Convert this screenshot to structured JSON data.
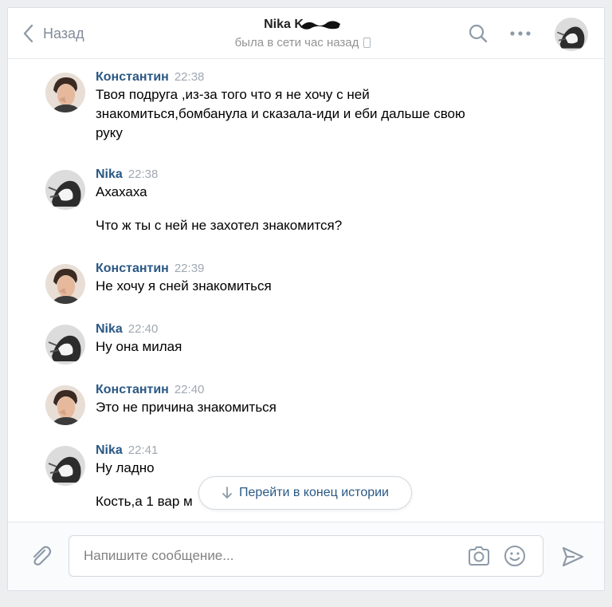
{
  "header": {
    "back_label": "Назад",
    "contact_name": "Nika K",
    "status": "была в сети час назад"
  },
  "messages": [
    {
      "author": "Константин",
      "time": "22:38",
      "texts": [
        "Твоя подруга ,из-за того что я не хочу с ней знакомиться,бомбанула и сказала-иди и еби дальше свою руку"
      ]
    },
    {
      "author": "Nika",
      "time": "22:38",
      "texts": [
        "Ахахаха",
        "Что ж ты с ней не захотел знакомится?"
      ]
    },
    {
      "author": "Константин",
      "time": "22:39",
      "texts": [
        "Не хочу я сней знакомиться"
      ]
    },
    {
      "author": "Nika",
      "time": "22:40",
      "texts": [
        "Ну она милая"
      ]
    },
    {
      "author": "Константин",
      "time": "22:40",
      "texts": [
        "Это не причина знакомиться"
      ]
    },
    {
      "author": "Nika",
      "time": "22:41",
      "texts": [
        "Ну ладно",
        "Кость,а 1 вар м"
      ]
    }
  ],
  "jump_button": {
    "label": "Перейти в конец истории"
  },
  "composer": {
    "placeholder": "Напишите сообщение..."
  },
  "colors": {
    "link": "#2a5885",
    "muted": "#818c99",
    "background": "#edeef0",
    "accent_icon": "#aeb7c2"
  },
  "icons": [
    "chevron-left-icon",
    "phone-icon",
    "search-icon",
    "more-icon",
    "paperclip-icon",
    "camera-icon",
    "smile-icon",
    "send-icon",
    "arrow-down-icon"
  ]
}
